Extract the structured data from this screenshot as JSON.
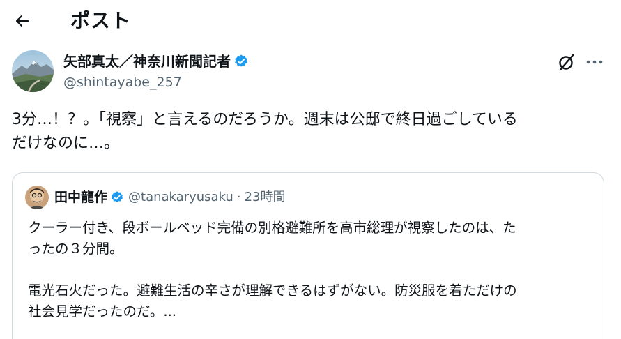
{
  "header": {
    "title": "ポスト",
    "back_icon": "arrow-left-icon"
  },
  "author": {
    "name": "矢部真太／神奈川新聞記者",
    "handle": "@shintayabe_257",
    "verified": true,
    "avatar": "mountain-landscape-avatar"
  },
  "post": {
    "text": "3分…！？。「視察」と言えるのだろうか。週末は公邸で終日過ごしている\nだけなのに…。"
  },
  "quote": {
    "name": "田中龍作",
    "handle": "@tanakaryusaku",
    "separator": "·",
    "time": "23時間",
    "verified": true,
    "text": "クーラー付き、段ボールベッド完備の別格避難所を高市総理が視察したのは、た\nったの３分間。\n\n電光石火だった。避難生活の辛さが理解できるはずがない。防災服を着ただけの\n社会見学だったのだ。..."
  },
  "colors": {
    "verified": "#1d9bf0",
    "secondary_text": "#536471",
    "border": "#cfd9de"
  },
  "icons": {
    "grok": "grok-icon",
    "more": "more-horizontal-icon"
  }
}
